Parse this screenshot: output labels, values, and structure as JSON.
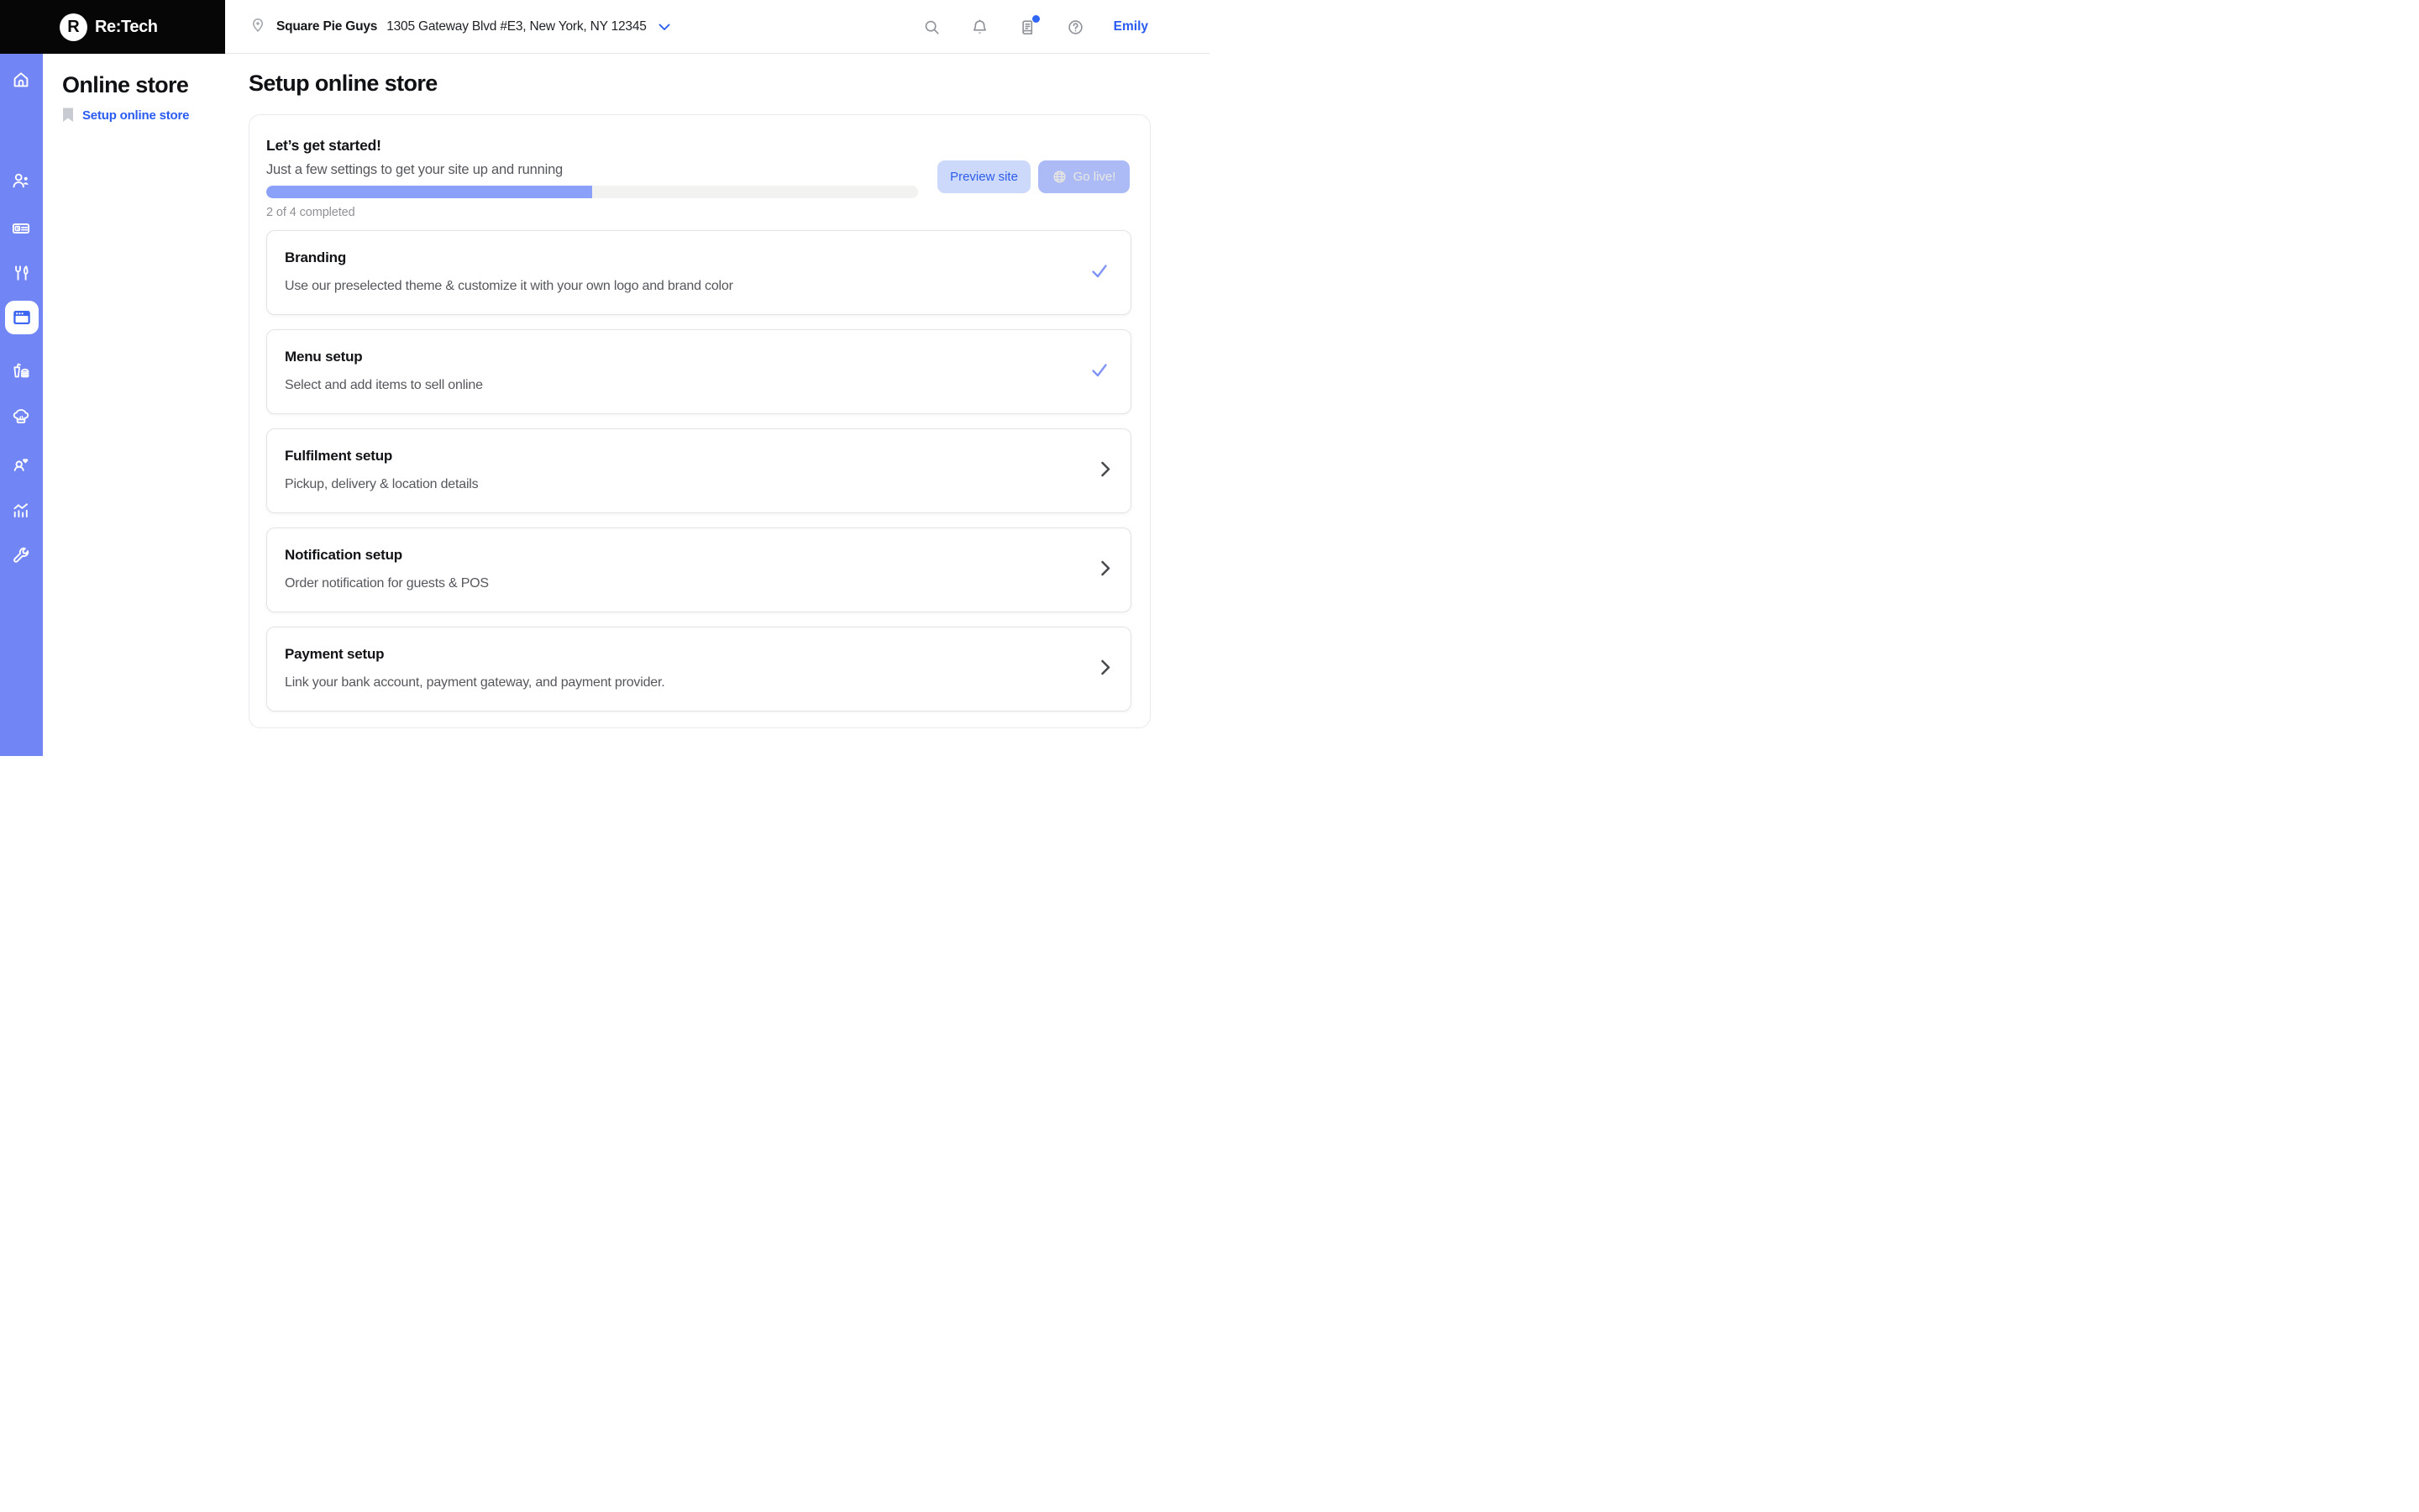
{
  "app": {
    "brand": "Re:Tech",
    "logo_letter": "R"
  },
  "colors": {
    "sidebar": "#7285f5",
    "accent_blue": "#2a5bf0",
    "progress_fill": "#8ba1f9",
    "progress_track": "#f2f2f1",
    "check": "#8094f6",
    "preview_button_bg": "#cdd9fb",
    "golive_button_bg": "#acbaf5",
    "selected_tile_icon": "#3d66f1"
  },
  "topbar": {
    "location": {
      "name": "Square Pie Guys",
      "address": "1305 Gateway Blvd #E3, New York, NY 12345"
    },
    "user": "Emily",
    "changelog_has_unread": true
  },
  "sidebar": {
    "items": [
      {
        "name": "home",
        "selected": false
      },
      {
        "name": "customers",
        "selected": false
      },
      {
        "name": "payouts",
        "selected": false
      },
      {
        "name": "dining",
        "selected": false
      },
      {
        "name": "online-store",
        "selected": true
      },
      {
        "name": "orders",
        "selected": false
      },
      {
        "name": "kitchen",
        "selected": false
      },
      {
        "name": "loyalty",
        "selected": false
      },
      {
        "name": "analytics",
        "selected": false
      },
      {
        "name": "tools",
        "selected": false
      }
    ]
  },
  "left_panel": {
    "title": "Online store",
    "nav": [
      {
        "label": "Setup online store",
        "active": true
      }
    ]
  },
  "main": {
    "heading": "Setup online store",
    "getting_started": {
      "title": "Let’s get started!",
      "subtitle": "Just a few settings to get your site up and running",
      "progress_percent": 50,
      "progress_label": "2 of 4 completed",
      "preview_button": "Preview site",
      "golive_button": "Go live!"
    },
    "steps": [
      {
        "title": "Branding",
        "description": "Use our preselected theme & customize it with your own logo and brand color",
        "status": "done"
      },
      {
        "title": "Menu setup",
        "description": "Select and add items to sell online",
        "status": "done"
      },
      {
        "title": "Fulfilment setup",
        "description": "Pickup, delivery & location details",
        "status": "todo"
      },
      {
        "title": "Notification setup",
        "description": "Order notification for guests & POS",
        "status": "todo"
      },
      {
        "title": "Payment setup",
        "description": "Link your bank account, payment gateway, and payment provider.",
        "status": "todo"
      }
    ]
  }
}
